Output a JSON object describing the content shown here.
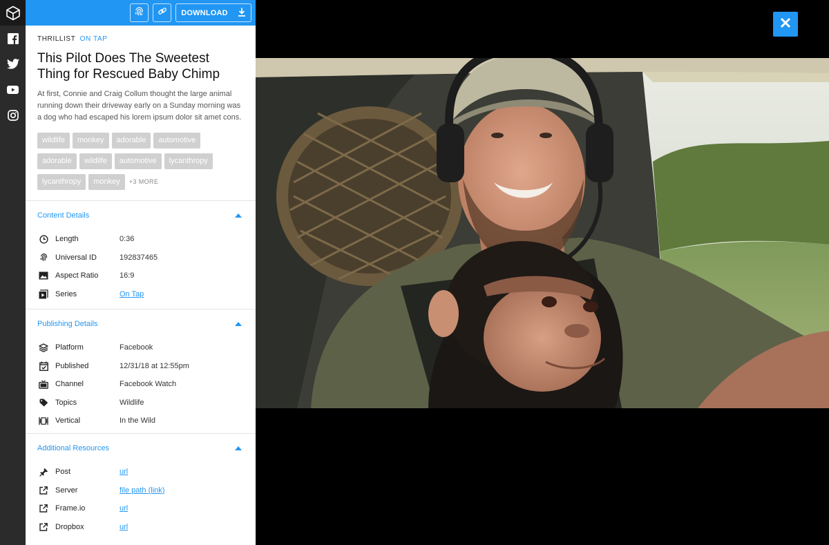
{
  "colors": {
    "accent": "#2196f3",
    "rail": "#2b2b2b",
    "tag_bg": "#d0d0d0"
  },
  "rail": {
    "logo_icon": "cube-logo-icon",
    "items": [
      {
        "icon": "facebook-icon"
      },
      {
        "icon": "twitter-icon"
      },
      {
        "icon": "youtube-icon"
      },
      {
        "icon": "instagram-icon"
      }
    ]
  },
  "toolbar": {
    "fingerprint_icon": "fingerprint-icon",
    "link_icon": "link-icon",
    "download_label": "DOWNLOAD",
    "download_icon": "download-icon"
  },
  "video": {
    "brand": "THRILLIST",
    "series": "ON TAP",
    "title": "This Pilot Does The Sweetest Thing for Rescued Baby Chimp",
    "description": "At first, Connie and Craig Collum thought the large animal running down their driveway early on a Sunday morning was a dog who had escaped his lorem ipsum dolor sit amet cons."
  },
  "tags": [
    "wildlife",
    "monkey",
    "adorable",
    "automotive",
    "adorable",
    "wildlife",
    "automotive",
    "lycanthropy",
    "lycanthropy",
    "monkey"
  ],
  "tags_more": "+3 MORE",
  "content_details": {
    "heading": "Content Details",
    "rows": [
      {
        "icon": "clock-icon",
        "label": "Length",
        "value": "0:36"
      },
      {
        "icon": "fingerprint-icon",
        "label": "Universal ID",
        "value": "192837465"
      },
      {
        "icon": "image-icon",
        "label": "Aspect Ratio",
        "value": "16:9"
      },
      {
        "icon": "series-play-icon",
        "label": "Series",
        "value": "On Tap"
      }
    ]
  },
  "publishing_details": {
    "heading": "Publishing Details",
    "rows": [
      {
        "icon": "layers-icon",
        "label": "Platform",
        "value": "Facebook"
      },
      {
        "icon": "calendar-check-icon",
        "label": "Published",
        "value": "12/31/18 at 12:55pm"
      },
      {
        "icon": "tv-icon",
        "label": "Channel",
        "value": "Facebook Watch"
      },
      {
        "icon": "tag-icon",
        "label": "Topics",
        "value": "Wildlife"
      },
      {
        "icon": "vertical-icon",
        "label": "Vertical",
        "value": "In the Wild"
      }
    ]
  },
  "additional_resources": {
    "heading": "Additional Resources",
    "rows": [
      {
        "icon": "pin-icon",
        "label": "Post",
        "value": "url"
      },
      {
        "icon": "external-link-icon",
        "label": "Server",
        "value": "file path (link)"
      },
      {
        "icon": "external-link-icon",
        "label": "Frame.io",
        "value": "url"
      },
      {
        "icon": "external-link-icon",
        "label": "Dropbox",
        "value": "url"
      }
    ]
  },
  "viewer": {
    "close_icon": "close-icon"
  }
}
